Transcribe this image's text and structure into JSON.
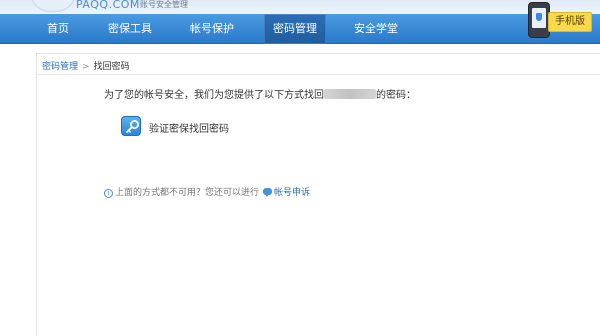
{
  "header": {
    "logo_text": "PAQQ.COM",
    "logo_sub": "账号安全管理"
  },
  "nav": {
    "items": [
      {
        "label": "首页"
      },
      {
        "label": "密保工具"
      },
      {
        "label": "帐号保护"
      },
      {
        "label": "密码管理"
      },
      {
        "label": "安全学堂"
      }
    ],
    "active_index": 3,
    "phone_tag": "手机版"
  },
  "breadcrumb": {
    "parent": "密码管理",
    "separator": ">",
    "current": "找回密码"
  },
  "main": {
    "intro_prefix": "为了您的帐号安全，我们为您提供了以下方式找回",
    "intro_suffix": "的密码：",
    "method_label": "验证密保找回密码",
    "other_text": "上面的方式都不可用？您还可以进行",
    "appeal_link": "帐号申诉"
  },
  "colors": {
    "nav_bg": "#2a7acb",
    "nav_active": "#1e5d9e",
    "link": "#2b6fb8",
    "tag_bg": "#f7d94a"
  },
  "icons": {
    "method": "key-icon",
    "info": "info-icon",
    "appeal": "chat-bubble-icon"
  }
}
